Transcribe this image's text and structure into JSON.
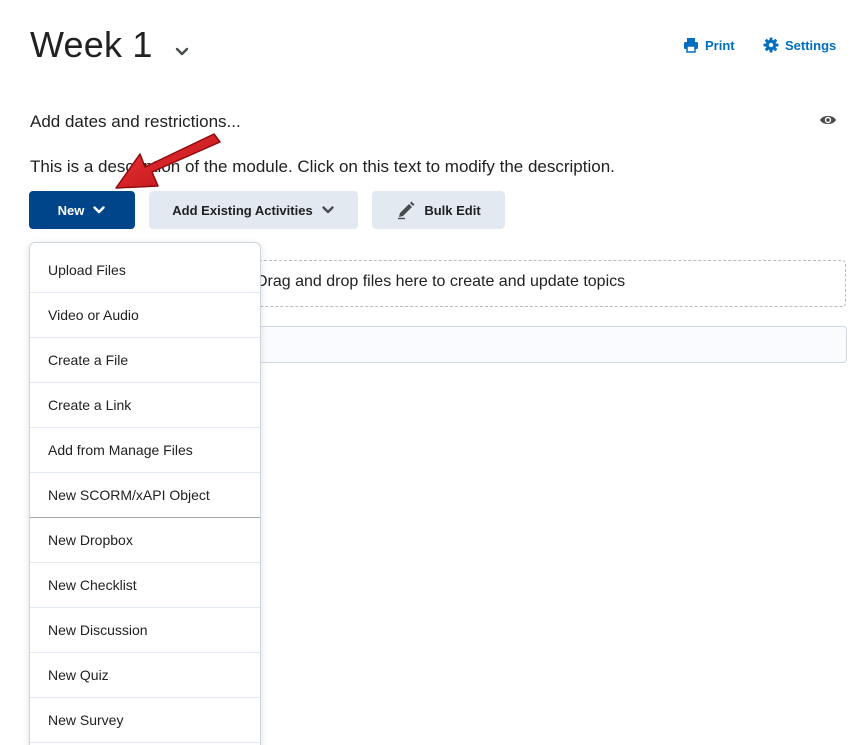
{
  "header": {
    "title": "Week 1",
    "print_label": "Print",
    "settings_label": "Settings"
  },
  "module": {
    "dates_link": "Add dates and restrictions...",
    "description": "This is a description of the module. Click on this text to modify the description."
  },
  "toolbar": {
    "new_label": "New",
    "add_existing_label": "Add Existing Activities",
    "bulk_edit_label": "Bulk Edit"
  },
  "dropzone": {
    "text": "Drag and drop files here to create and update topics"
  },
  "new_menu": {
    "items": [
      "Upload Files",
      "Video or Audio",
      "Create a File",
      "Create a Link",
      "Add from Manage Files",
      "New SCORM/xAPI Object",
      "New Dropbox",
      "New Checklist",
      "New Discussion",
      "New Quiz",
      "New Survey"
    ]
  },
  "colors": {
    "primary": "#004489",
    "link": "#006fbf",
    "secondary_button": "#e3e9f1",
    "annotation_arrow": "#d8181c"
  },
  "icons": {
    "print": "printer-icon",
    "settings": "gear-icon",
    "visibility": "eye-icon",
    "bulk_edit": "pencil-icon",
    "dropdown": "chevron-down-icon"
  }
}
